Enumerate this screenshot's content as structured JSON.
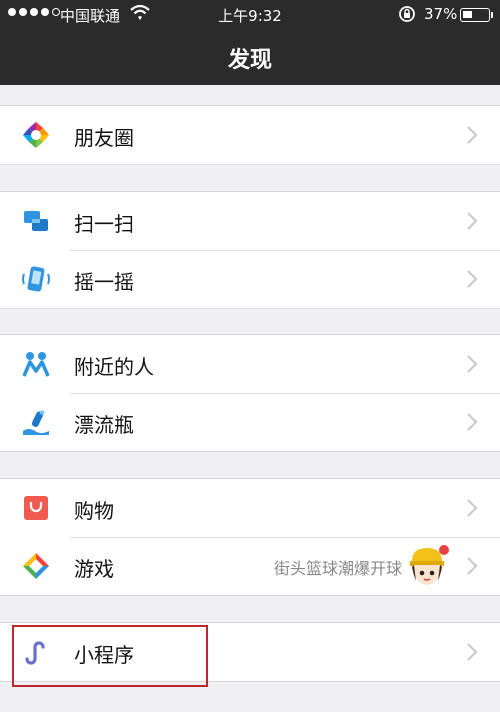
{
  "statusbar": {
    "carrier": "中国联通",
    "time": "上午9:32",
    "battery": "37%",
    "signal_bars_filled": 4,
    "battery_level": 0.37
  },
  "navbar": {
    "title": "发现"
  },
  "menu": {
    "moments": {
      "label": "朋友圈",
      "icon": "moments-aperture-icon"
    },
    "scan": {
      "label": "扫一扫",
      "icon": "scan-icon"
    },
    "shake": {
      "label": "摇一摇",
      "icon": "shake-phone-icon"
    },
    "nearby": {
      "label": "附近的人",
      "icon": "people-nearby-icon"
    },
    "bottle": {
      "label": "漂流瓶",
      "icon": "drift-bottle-icon"
    },
    "shopping": {
      "label": "购物",
      "icon": "shopping-bag-icon"
    },
    "games": {
      "label": "游戏",
      "icon": "games-icon",
      "subtitle": "街头篮球潮爆开球",
      "has_badge": true
    },
    "miniprogram": {
      "label": "小程序",
      "icon": "mini-program-icon"
    }
  },
  "colors": {
    "header_bg": "#2b2b2b",
    "page_bg": "#efeff4",
    "highlight_border": "#c0272d",
    "badge": "#e64340"
  }
}
